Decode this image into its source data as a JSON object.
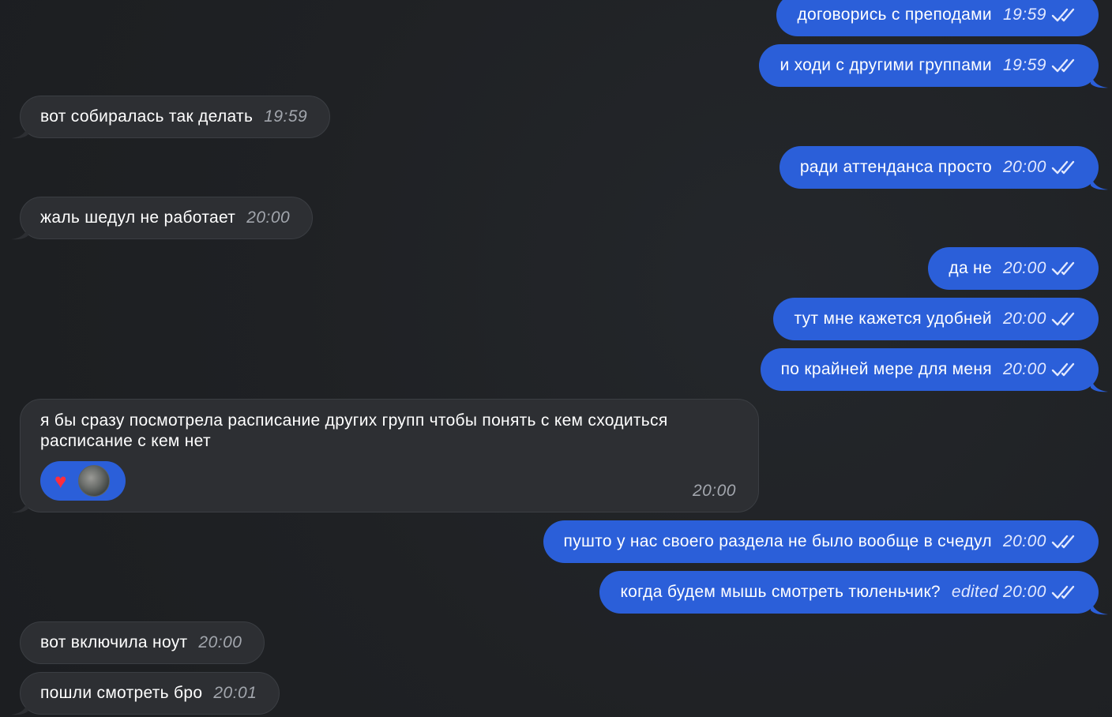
{
  "messages": [
    {
      "id": "m1",
      "dir": "out",
      "text": "договорись с преподами",
      "time": "19:59",
      "read": true
    },
    {
      "id": "m2",
      "dir": "out",
      "text": "и ходи с другими группами",
      "time": "19:59",
      "read": true
    },
    {
      "id": "m3",
      "dir": "in",
      "text": "вот собиралась так делать",
      "time": "19:59"
    },
    {
      "id": "m4",
      "dir": "out",
      "text": "ради аттенданса просто",
      "time": "20:00",
      "read": true
    },
    {
      "id": "m5",
      "dir": "in",
      "text": "жаль шедул не работает",
      "time": "20:00"
    },
    {
      "id": "m6",
      "dir": "out",
      "text": "да не",
      "time": "20:00",
      "read": true
    },
    {
      "id": "m7",
      "dir": "out",
      "text": "тут мне кажется удобней",
      "time": "20:00",
      "read": true
    },
    {
      "id": "m8",
      "dir": "out",
      "text": "по крайней мере для меня",
      "time": "20:00",
      "read": true
    },
    {
      "id": "m9",
      "dir": "in",
      "text_line1": "я бы сразу посмотрела расписание других групп чтобы понять с кем сходиться",
      "text_line2": "расписание с кем нет",
      "time": "20:00",
      "reaction": {
        "emoji": "♥",
        "icon": "heart-reaction-icon"
      }
    },
    {
      "id": "m10",
      "dir": "out",
      "text": "пушто у нас своего раздела не было вообще в счедул",
      "time": "20:00",
      "read": true
    },
    {
      "id": "m11",
      "dir": "out",
      "text": "когда будем мышь смотреть тюленьчик?",
      "edited_label": "edited",
      "time": "20:00",
      "read": true
    },
    {
      "id": "m12",
      "dir": "in",
      "text": "вот включила ноут",
      "time": "20:00"
    },
    {
      "id": "m13",
      "dir": "in",
      "text": "пошли смотреть бро",
      "time": "20:01"
    }
  ],
  "colors": {
    "outgoing_bubble": "#2b5fd9",
    "incoming_bubble": "#2d2f33",
    "background": "#202225"
  }
}
